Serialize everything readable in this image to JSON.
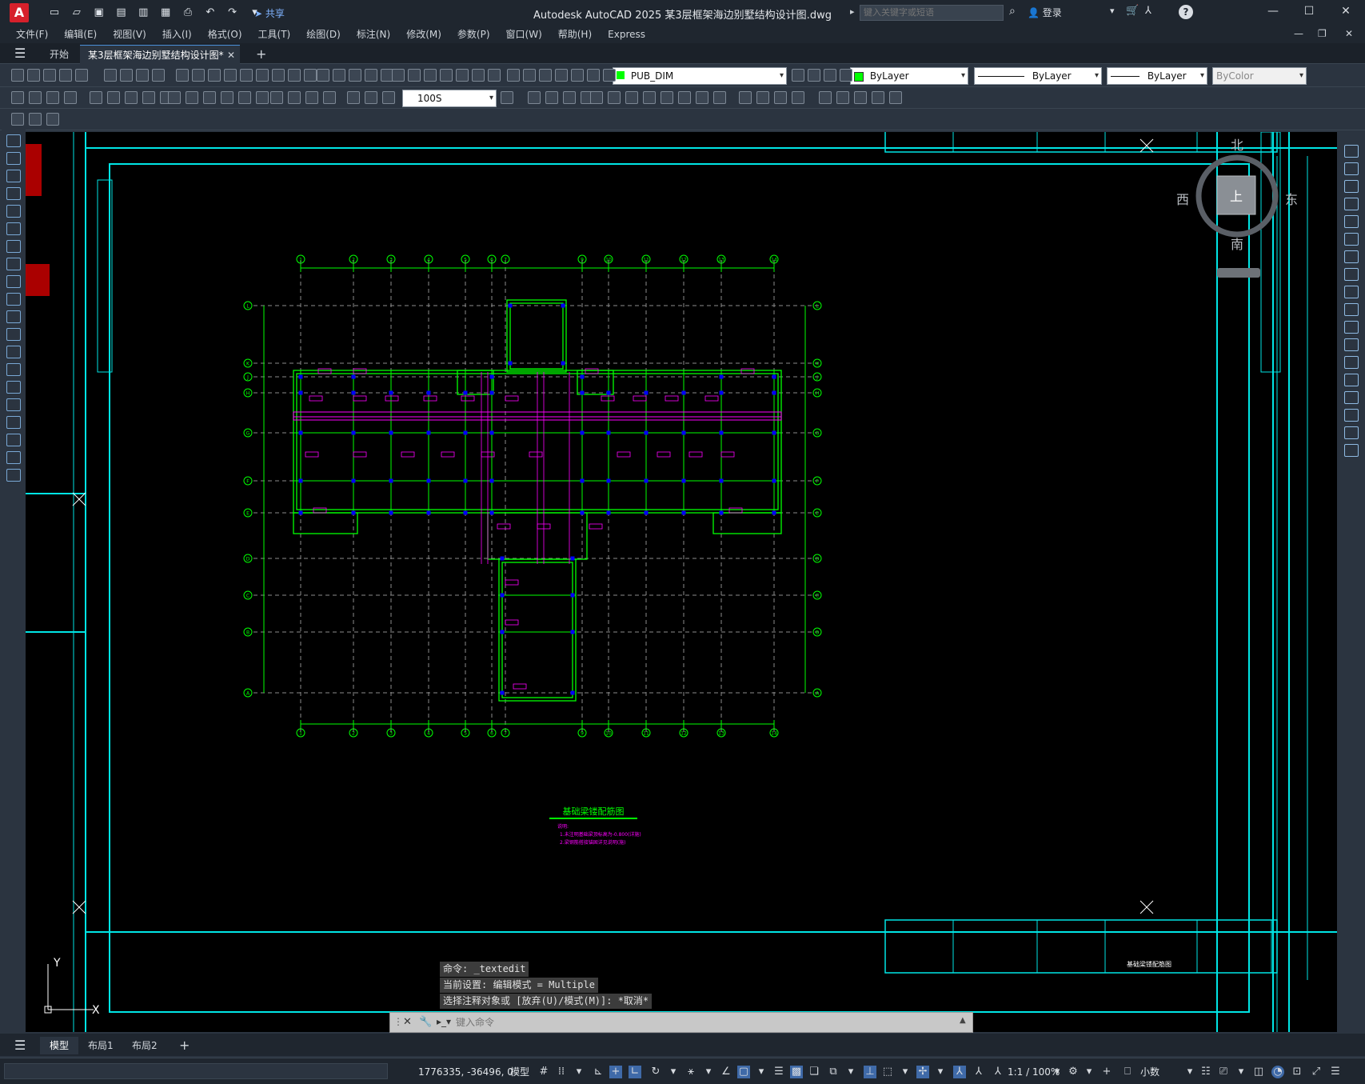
{
  "app": {
    "title": "Autodesk AutoCAD 2025    某3层框架海边别墅结构设计图.dwg",
    "logo": "A",
    "share_label": "共享",
    "search_placeholder": "键入关键字或短语",
    "signin_label": "登录",
    "help_label": "?"
  },
  "menu": [
    "文件(F)",
    "编辑(E)",
    "视图(V)",
    "插入(I)",
    "格式(O)",
    "工具(T)",
    "绘图(D)",
    "标注(N)",
    "修改(M)",
    "参数(P)",
    "窗口(W)",
    "帮助(H)",
    "Express"
  ],
  "tabs": {
    "start": "开始",
    "document": "某3层框架海边别墅结构设计图*",
    "close": "✕",
    "new": "+"
  },
  "toolbar": {
    "layer_name": "PUB_DIM",
    "color": "ByLayer",
    "linetype": "ByLayer",
    "lineweight": "ByLayer",
    "plotstyle": "ByColor",
    "scale": "100S"
  },
  "viewcube": {
    "north": "北",
    "south": "南",
    "east": "东",
    "west": "西",
    "face": "上"
  },
  "drawing": {
    "plan_title": "基础梁镂配筋图",
    "notes": [
      "说明:",
      "1.未注明基础梁顶标高为-0.800(详施)",
      "2.梁钢筋搭接锚固详见说明(施)"
    ],
    "grid_numbers": [
      "1",
      "2",
      "3",
      "4",
      "5",
      "6",
      "7",
      "8",
      "9",
      "10",
      "11",
      "12",
      "13",
      "14"
    ],
    "grid_letters": [
      "L",
      "K",
      "J",
      "H",
      "G",
      "F",
      "E",
      "D",
      "C",
      "B",
      "A"
    ],
    "titleblock_name": "基础梁镂配筋图"
  },
  "ucs": {
    "y": "Y",
    "x": "X"
  },
  "command": {
    "history": [
      "命令: _textedit",
      "当前设置: 编辑模式 = Multiple",
      "选择注释对象或 [放弃(U)/模式(M)]: *取消*"
    ],
    "placeholder": "键入命令"
  },
  "layouts": {
    "model": "模型",
    "layout1": "布局1",
    "layout2": "布局2",
    "add": "+"
  },
  "status": {
    "coords": "1776335, -36496, 0",
    "space": "模型",
    "scale": "1:1 / 100%",
    "units": "小数"
  },
  "colors": {
    "bg": "#000000",
    "cyan": "#00e5e5",
    "green": "#00ff00",
    "magenta": "#ff00ff",
    "blue": "#0000ff",
    "gray": "#8c8c8c"
  }
}
